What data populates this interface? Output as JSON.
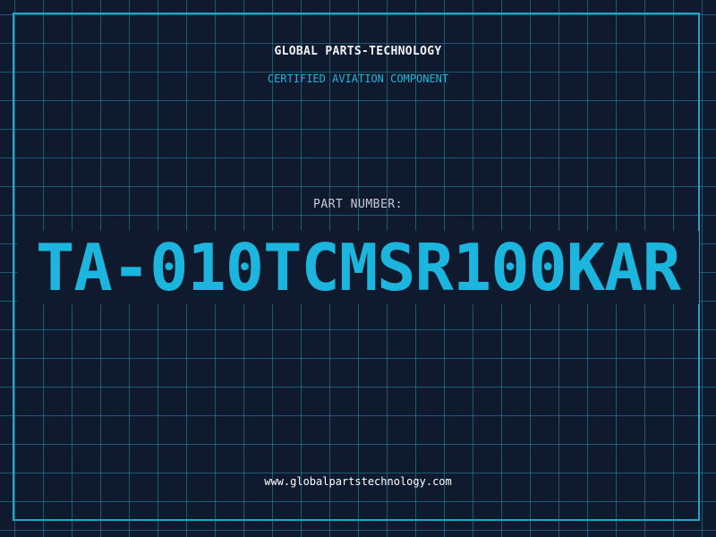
{
  "header": {
    "company_name": "GLOBAL PARTS-TECHNOLOGY",
    "subtitle": "CERTIFIED AVIATION COMPONENT"
  },
  "part": {
    "label": "PART NUMBER:",
    "number": "TA-010TCMSR100KAR"
  },
  "footer": {
    "website": "www.globalpartstechnology.com"
  },
  "colors": {
    "background": "#101a2e",
    "grid": "#288caa",
    "frame": "#1fa6c9",
    "accent": "#1cb5de"
  }
}
